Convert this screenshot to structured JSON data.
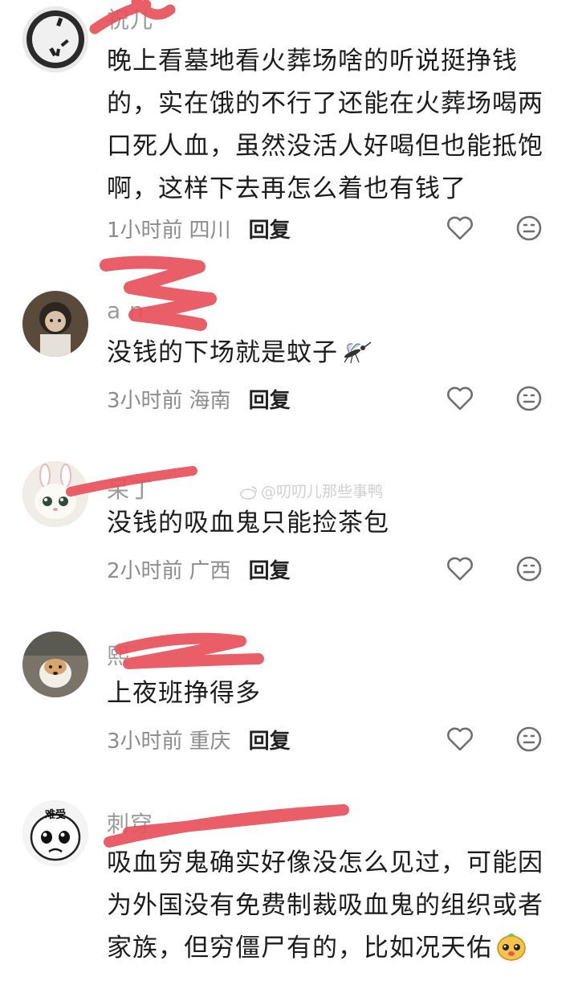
{
  "comments": [
    {
      "username": "祝儿",
      "text": "晚上看墓地看火葬场啥的听说挺挣钱的，实在饿的不行了还能在火葬场喝两口死人血，虽然没活人好喝但也能抵饱啊，这样下去再怎么着也有钱了",
      "time": "1小时前",
      "location": "四川",
      "reply": "回复"
    },
    {
      "username": "a  n",
      "text": "没钱的下场就是蚊子",
      "time": "3小时前",
      "location": "海南",
      "reply": "回复"
    },
    {
      "username": "呆丁",
      "text": "没钱的吸血鬼只能捡茶包",
      "time": "2小时前",
      "location": "广西",
      "reply": "回复"
    },
    {
      "username": "熙",
      "text": "上夜班挣得多",
      "time": "3小时前",
      "location": "重庆",
      "reply": "回复"
    },
    {
      "username": "刺穿",
      "text": "吸血穷鬼确实好像没怎么见过，可能因为外国没有免费制裁吸血鬼的组织或者家族，但穷僵尸有的，比如况天佑",
      "avatar_text": "难受",
      "time": "",
      "location": "",
      "reply": ""
    }
  ],
  "watermark": "@叨叨儿那些事鸭",
  "colors": {
    "scribble": "#e8505b",
    "meta": "#8c8c8c"
  }
}
